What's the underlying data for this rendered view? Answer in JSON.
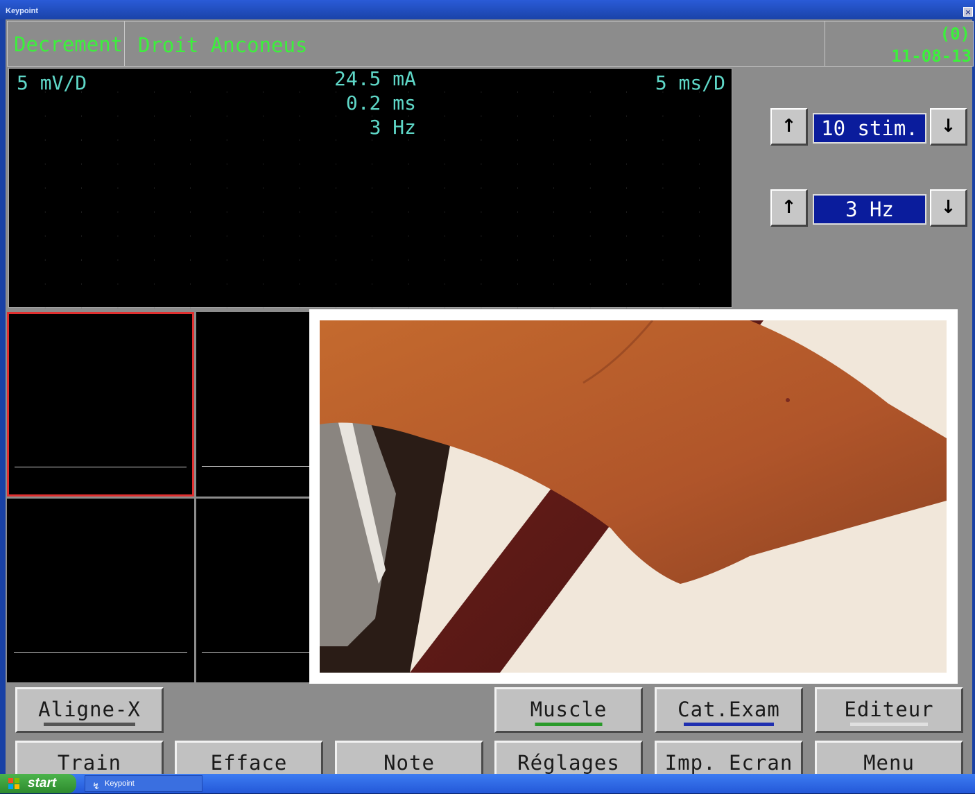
{
  "window": {
    "title": "Keypoint",
    "close_glyph": "×"
  },
  "header": {
    "mode": "Decrement",
    "muscle": "Droit Anconeus",
    "counter": "(0)",
    "date": "11-08-13"
  },
  "scope": {
    "sensitivity": "5 mV/D",
    "current": "24.5 mA",
    "duration": "0.2 ms",
    "frequency": "3 Hz",
    "sweep": "5 ms/D"
  },
  "controls": {
    "stim_count": "10 stim.",
    "rate": "3 Hz",
    "up_glyph": "↑",
    "down_glyph": "↓"
  },
  "buttons": {
    "row1": [
      {
        "label": "Aligne-X",
        "underline": "#555555"
      },
      {
        "label": "Muscle",
        "underline": "#2a9a2a"
      },
      {
        "label": "Cat.Exam",
        "underline": "#1f2fb0"
      },
      {
        "label": "Editeur",
        "underline": "#e0e0e0"
      }
    ],
    "row2": [
      {
        "label": "Train"
      },
      {
        "label": "Efface"
      },
      {
        "label": "Note"
      },
      {
        "label": "Réglages"
      },
      {
        "label": "Imp. Ecran"
      },
      {
        "label": "Menu"
      }
    ]
  },
  "taskbar": {
    "start": "start",
    "task": "Keypoint"
  },
  "colors": {
    "header_text": "#3cf03c",
    "scope_text": "#5fd8c8",
    "value_box": "#0a1c9c",
    "selected_cell_border": "#e03030"
  }
}
